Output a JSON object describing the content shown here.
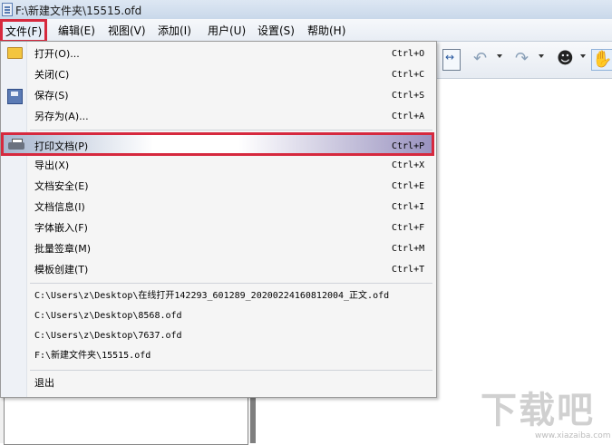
{
  "window": {
    "title": "F:\\新建文件夹\\15515.ofd"
  },
  "menubar": {
    "items": [
      {
        "label": "文件(F)",
        "active": true
      },
      {
        "label": "编辑(E)"
      },
      {
        "label": "视图(V)"
      },
      {
        "label": "添加(I)"
      },
      {
        "label": "用户(U)"
      },
      {
        "label": "设置(S)"
      },
      {
        "label": "帮助(H)"
      }
    ]
  },
  "file_menu": {
    "items": [
      {
        "label": "打开(O)...",
        "shortcut": "Ctrl+O",
        "icon": "folder-icon"
      },
      {
        "label": "关闭(C)",
        "shortcut": "Ctrl+C"
      },
      {
        "label": "保存(S)",
        "shortcut": "Ctrl+S",
        "icon": "save-icon"
      },
      {
        "label": "另存为(A)...",
        "shortcut": "Ctrl+A"
      },
      {
        "label": "打印文档(P)",
        "shortcut": "Ctrl+P",
        "icon": "printer-icon",
        "highlighted": true
      },
      {
        "label": "导出(X)",
        "shortcut": "Ctrl+X"
      },
      {
        "label": "文档安全(E)",
        "shortcut": "Ctrl+E"
      },
      {
        "label": "文档信息(I)",
        "shortcut": "Ctrl+I"
      },
      {
        "label": "字体嵌入(F)",
        "shortcut": "Ctrl+F"
      },
      {
        "label": "批量签章(M)",
        "shortcut": "Ctrl+M"
      },
      {
        "label": "模板创建(T)",
        "shortcut": "Ctrl+T"
      }
    ],
    "recent_files": [
      "C:\\Users\\z\\Desktop\\在线打开142293_601289_20200224160812004_正文.ofd",
      "C:\\Users\\z\\Desktop\\8568.ofd",
      "C:\\Users\\z\\Desktop\\7637.ofd",
      "F:\\新建文件夹\\15515.ofd"
    ],
    "exit_label": "退出"
  },
  "watermark": {
    "text": "下载吧",
    "sub": "www.xiazaiba.com"
  },
  "colors": {
    "highlight_border": "#d6293e",
    "menu_bg": "#f5f5f5"
  }
}
